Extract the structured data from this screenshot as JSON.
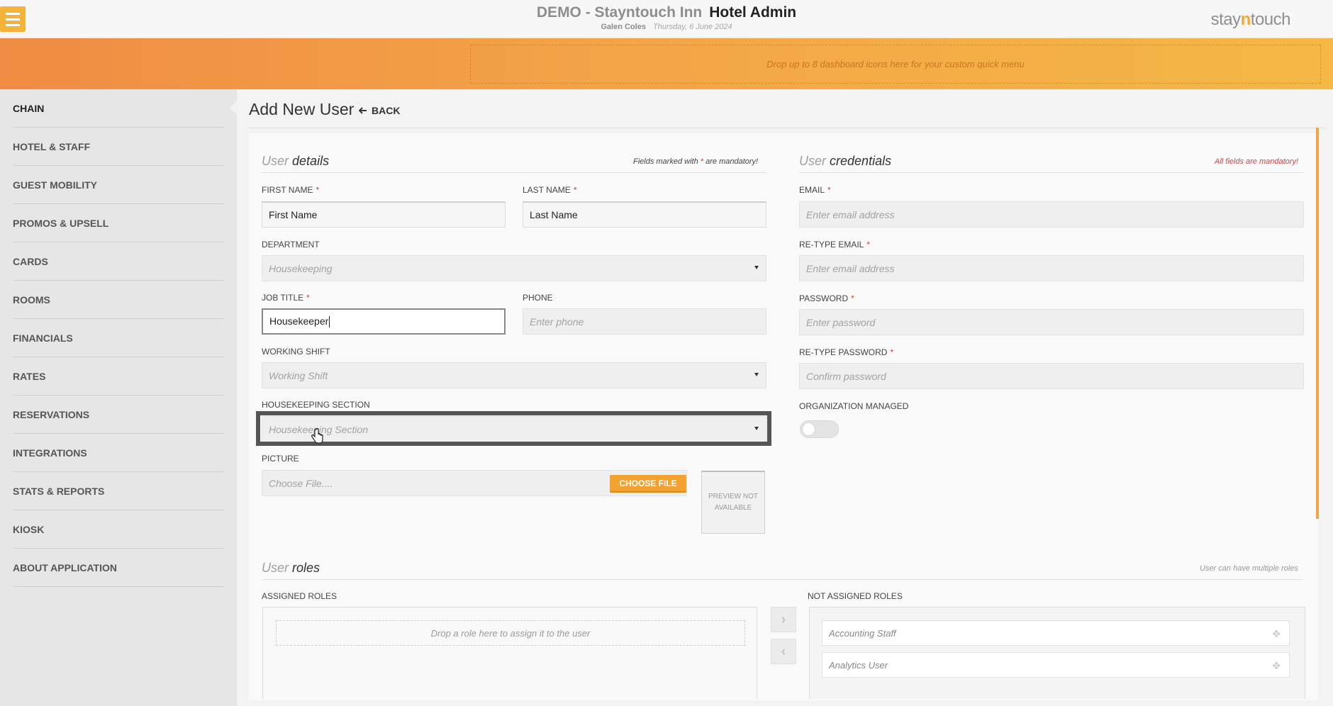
{
  "header": {
    "property": "DEMO - Stayntouch Inn",
    "app": "Hotel Admin",
    "user": "Galen Coles",
    "date": "Thursday, 6 June 2024",
    "logo_pre": "stay",
    "logo_mid": "n",
    "logo_post": "touch",
    "quick_menu_hint": "Drop up to 8 dashboard icons here for your custom quick menu"
  },
  "sidebar": {
    "items": [
      {
        "label": "CHAIN"
      },
      {
        "label": "HOTEL & STAFF"
      },
      {
        "label": "GUEST MOBILITY"
      },
      {
        "label": "PROMOS & UPSELL"
      },
      {
        "label": "CARDS"
      },
      {
        "label": "ROOMS"
      },
      {
        "label": "FINANCIALS"
      },
      {
        "label": "RATES"
      },
      {
        "label": "RESERVATIONS"
      },
      {
        "label": "INTEGRATIONS"
      },
      {
        "label": "STATS & REPORTS"
      },
      {
        "label": "KIOSK"
      },
      {
        "label": "ABOUT APPLICATION"
      }
    ]
  },
  "page": {
    "title": "Add New User",
    "back_label": "BACK"
  },
  "user_details": {
    "heading_light": "User",
    "heading_dark": "details",
    "note_pre": "Fields marked with",
    "note_star": "*",
    "note_post": "are mandatory!",
    "first_name": {
      "label": "FIRST NAME",
      "value": "First Name"
    },
    "last_name": {
      "label": "LAST NAME",
      "value": "Last Name"
    },
    "department": {
      "label": "DEPARTMENT",
      "value": "Housekeeping"
    },
    "job_title": {
      "label": "JOB TITLE",
      "value": "Housekeeper"
    },
    "phone": {
      "label": "PHONE",
      "placeholder": "Enter phone"
    },
    "working_shift": {
      "label": "WORKING SHIFT",
      "placeholder": "Working Shift"
    },
    "housekeeping_section": {
      "label": "HOUSEKEEPING SECTION",
      "placeholder": "Housekeeping Section"
    },
    "picture": {
      "label": "PICTURE",
      "placeholder": "Choose File....",
      "button": "CHOOSE FILE",
      "preview": "PREVIEW NOT AVAILABLE"
    }
  },
  "credentials": {
    "heading_light": "User",
    "heading_dark": "credentials",
    "note": "All fields are mandatory!",
    "email": {
      "label": "EMAIL",
      "placeholder": "Enter email address"
    },
    "retype_email": {
      "label": "RE-TYPE EMAIL",
      "placeholder": "Enter email address"
    },
    "password": {
      "label": "PASSWORD",
      "placeholder": "Enter password"
    },
    "retype_password": {
      "label": "RE-TYPE PASSWORD",
      "placeholder": "Confirm password"
    },
    "org_managed": {
      "label": "ORGANIZATION MANAGED",
      "value": "off"
    }
  },
  "roles": {
    "heading_light": "User",
    "heading_dark": "roles",
    "note": "User can have multiple roles",
    "assigned_label": "ASSIGNED ROLES",
    "assigned_hint": "Drop a role here to assign it to the user",
    "not_assigned_label": "NOT ASSIGNED ROLES",
    "not_assigned": [
      {
        "label": "Accounting Staff"
      },
      {
        "label": "Analytics User"
      }
    ]
  },
  "required_mark": "*",
  "colors": {
    "accent": "#f3a230",
    "band_start": "#f08c43",
    "band_end": "#f5b845",
    "required": "#d03a3a"
  }
}
